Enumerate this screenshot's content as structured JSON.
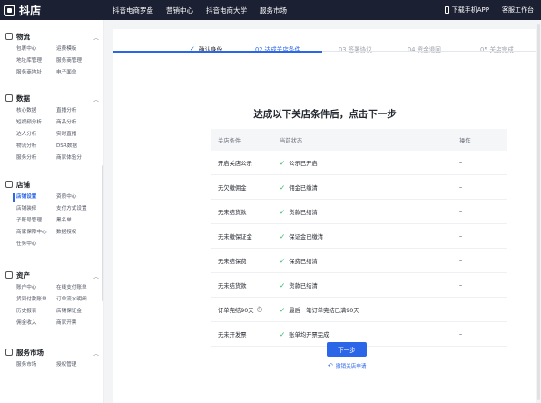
{
  "topbar": {
    "logo": "抖店",
    "nav": [
      "抖音电商罗盘",
      "营销中心",
      "抖音电商大学",
      "服务市场"
    ],
    "download": "下载手机APP",
    "workbench": "客服工作台"
  },
  "sidebar": {
    "sections": [
      {
        "title": "物流",
        "items": [
          "包裹中心",
          "运费模板",
          "地址库管理",
          "服务商管理",
          "服务商地址",
          "电子面单"
        ]
      },
      {
        "title": "数据",
        "items": [
          "核心数据",
          "直播分析",
          "短视频分析",
          "商品分析",
          "达人分析",
          "实时直播",
          "物流分析",
          "DSR数据",
          "服务分析",
          "商家体验分"
        ]
      },
      {
        "title": "店铺",
        "items": [
          "店铺设置",
          "资质中心",
          "店铺装修",
          "支付方式设置",
          "子账号管理",
          "黑名单",
          "商家保障中心",
          "数据授权",
          "任务中心"
        ]
      },
      {
        "title": "资产",
        "items": [
          "账户中心",
          "在线支付账单",
          "货到付款账单",
          "订单流水明细",
          "历史报表",
          "店铺保证金",
          "佣金收入",
          "商家开票"
        ]
      },
      {
        "title": "服务市场",
        "items": [
          "服务市场",
          "授权管理"
        ]
      }
    ],
    "active_item": "店铺设置"
  },
  "steps": [
    {
      "label": "确认身份",
      "state": "done"
    },
    {
      "label": "02 达成关店条件",
      "state": "current"
    },
    {
      "label": "03 签署协议",
      "state": "todo"
    },
    {
      "label": "04 资金退回",
      "state": "todo"
    },
    {
      "label": "05 关店完成",
      "state": "todo"
    }
  ],
  "title": "达成以下关店条件后，点击下一步",
  "table": {
    "headers": [
      "关店条件",
      "当前状态",
      "操作"
    ],
    "rows": [
      {
        "condition": "开启关店公示",
        "status": "公示已开启",
        "action": "–"
      },
      {
        "condition": "无欠缴佣金",
        "status": "佣金已缴清",
        "action": "–"
      },
      {
        "condition": "无未结货款",
        "status": "货款已结清",
        "action": "–"
      },
      {
        "condition": "无未缴保证金",
        "status": "保证金已缴清",
        "action": "–"
      },
      {
        "condition": "无未结保费",
        "status": "保费已结清",
        "action": "–"
      },
      {
        "condition": "无未结货款",
        "status": "货款已结清",
        "action": "–"
      },
      {
        "condition": "订单完结90天",
        "status": "最后一笔订单完结已满90天",
        "action": "–"
      },
      {
        "condition": "无未开发票",
        "status": "账单均开票完成",
        "action": "–"
      }
    ]
  },
  "buttons": {
    "next": "下一步",
    "revoke": "撤销关店申请"
  },
  "colors": {
    "primary": "#2c66e8",
    "success": "#22b55e",
    "topbar": "#1c2033"
  }
}
